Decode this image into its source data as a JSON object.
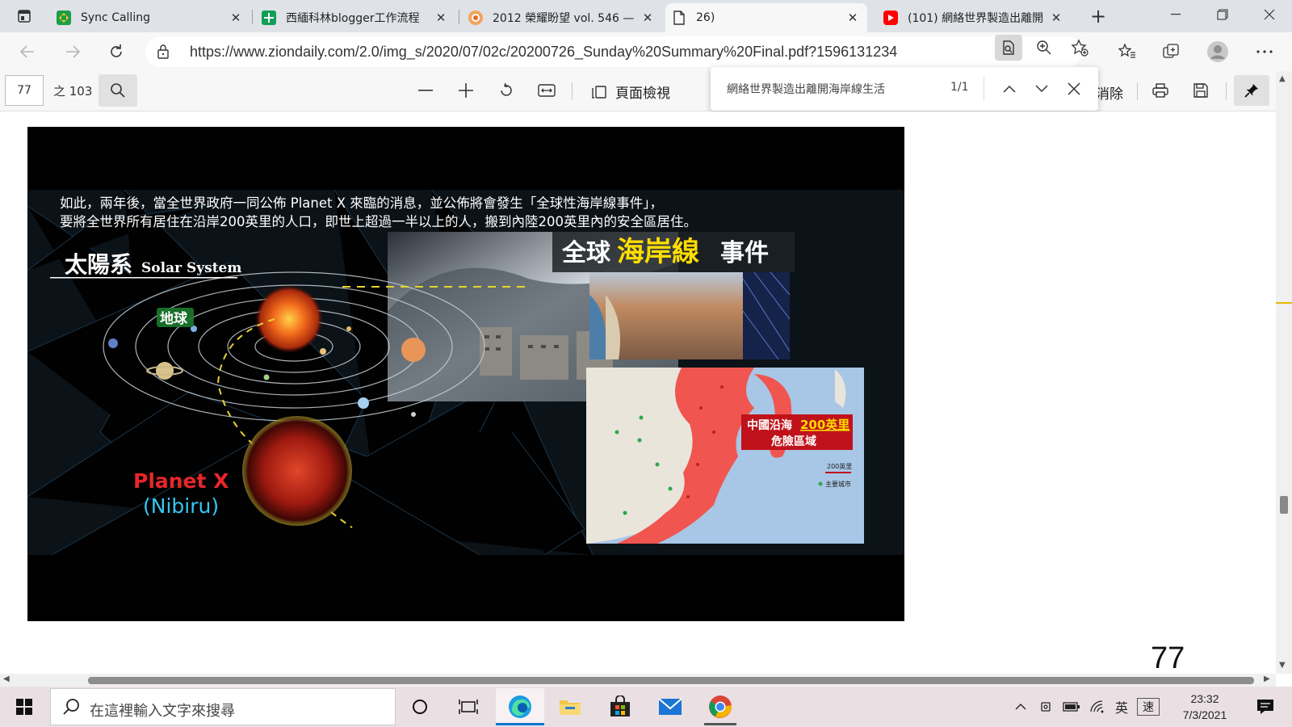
{
  "browser": {
    "tabs": [
      {
        "title": "Sync Calling",
        "icon": "google-sheets-green-icon",
        "active": false
      },
      {
        "title": "西緬科林blogger工作流程",
        "icon": "google-sheets-icon",
        "active": false
      },
      {
        "title": "2012 榮耀盼望 vol. 546 —",
        "icon": "zion-daily-icon",
        "active": false
      },
      {
        "title": "26)",
        "icon": "document-icon",
        "active": true
      },
      {
        "title": "(101) 網絡世界製造出離開",
        "icon": "youtube-icon",
        "active": false
      }
    ],
    "new_tab_label": "+",
    "url": "https://www.ziondaily.com/2.0/img_s/2020/07/02c/20200726_Sunday%20Summary%20Final.pdf?1596131234"
  },
  "pdf_toolbar": {
    "page_value": "77",
    "page_total": "之 103",
    "page_view_label": "頁面檢視",
    "erase_label": "消除"
  },
  "find_bar": {
    "query": "網絡世界製造出離開海岸線生活",
    "count": "1/1"
  },
  "document": {
    "page_number": "77",
    "slide": {
      "caption_line1": "如此，兩年後，當全世界政府一同公佈 Planet X 來臨的消息，並公佈將會發生「全球性海岸線事件」，",
      "caption_line2": "要將全世界所有居住在沿岸200英里的人口，即世上超過一半以上的人，搬到內陸200英里內的安全區居住。",
      "solar_title_zh": "太陽系",
      "solar_title_en": "Solar System",
      "earth_label": "地球",
      "planet_x_label": "Planet X",
      "nibiru_label": "(Nibiru)",
      "event_part1": "全球",
      "event_part2": "海岸線",
      "event_part3": "事件",
      "map_title_part1": "中國沿海",
      "map_title_part2": "200英里",
      "map_title_line2": "危險區域",
      "legend_distance": "200英里",
      "legend_cities": "主要城市"
    }
  },
  "taskbar": {
    "search_placeholder": "在這裡輸入文字來搜尋",
    "ime_label": "英",
    "ime_speed_label": "速",
    "time": "23:32",
    "date": "7/3/2021"
  },
  "colors": {
    "accent": "#0078d4",
    "find_marker": "#e6b800",
    "planet_x_red": "#e8262a",
    "nibiru_cyan": "#35c7f0",
    "event_yellow": "#ffde00",
    "map_danger": "#f0554f"
  }
}
